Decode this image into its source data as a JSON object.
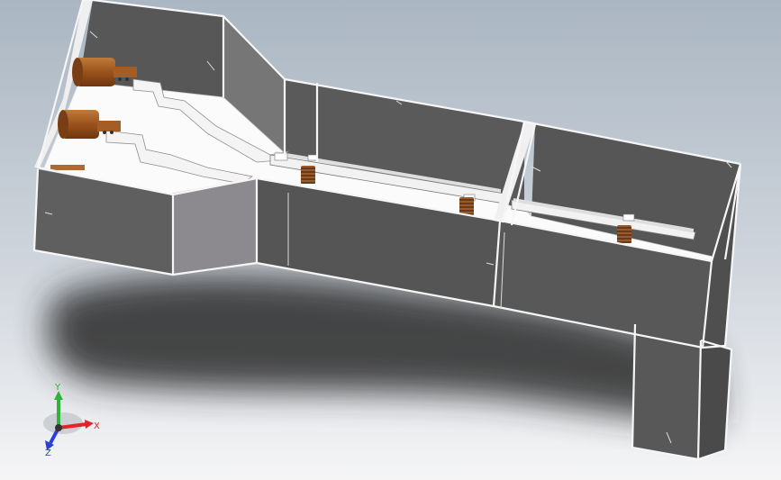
{
  "view": {
    "background_top": "#aebac6",
    "background_bottom": "#f3f3f4",
    "body_face_color": "#5b5b5b",
    "body_face_light": "#6e6e6e",
    "body_edge_color": "#f4f4f4",
    "floor_color": "#ffffff",
    "busbar_color": "#f7f7f7",
    "copper_color": "#a15a22",
    "spring_color": "#9b5a2b",
    "shadow_color": "#262626"
  },
  "triad": {
    "x_label": "X",
    "y_label": "Y",
    "z_label": "Z",
    "x_color": "#e0242a",
    "y_color": "#2fb33a",
    "z_color": "#2a3fd6",
    "x_icon": "axis-x-arrow-icon",
    "y_icon": "axis-y-arrow-icon",
    "z_icon": "axis-z-arrow-icon"
  }
}
